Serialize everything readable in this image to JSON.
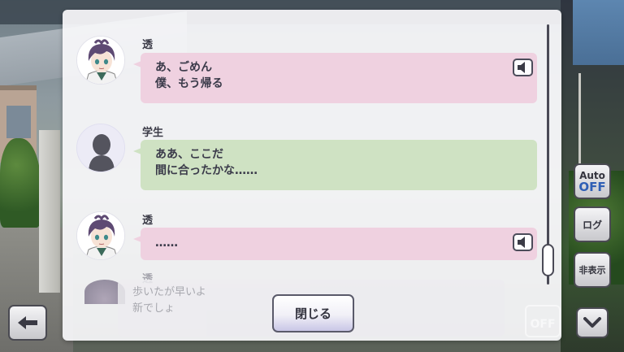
{
  "backlog": {
    "entries": [
      {
        "speaker": "透",
        "lines": [
          "あ、ごめん",
          "僕、もう帰る"
        ],
        "bubble_color": "#efd1e0",
        "avatar": "toru-portrait",
        "has_voice": true
      },
      {
        "speaker": "学生",
        "lines": [
          "ああ、ここだ",
          "間に合ったかな……"
        ],
        "bubble_color": "#cfe2c3",
        "avatar": "silhouette",
        "has_voice": false
      },
      {
        "speaker": "透",
        "lines": [
          "……"
        ],
        "bubble_color": "#efd1e0",
        "avatar": "toru-portrait",
        "has_voice": true
      }
    ],
    "faded_entry": {
      "speaker": "透",
      "lines": [
        "歩いたが早いよ",
        "新でしょ"
      ]
    },
    "close_label": "閉じる"
  },
  "hud": {
    "back_icon": "left-arrow-icon",
    "auto_label": "Auto",
    "auto_state": "OFF",
    "log_label": "ログ",
    "hide_label": "非表示",
    "down_icon": "chevron-down-icon",
    "ghost_off_label": "OFF"
  },
  "colors": {
    "pink_bubble": "#efd1e0",
    "green_bubble": "#cfe2c3",
    "auto_off": "#2f5fb5"
  }
}
